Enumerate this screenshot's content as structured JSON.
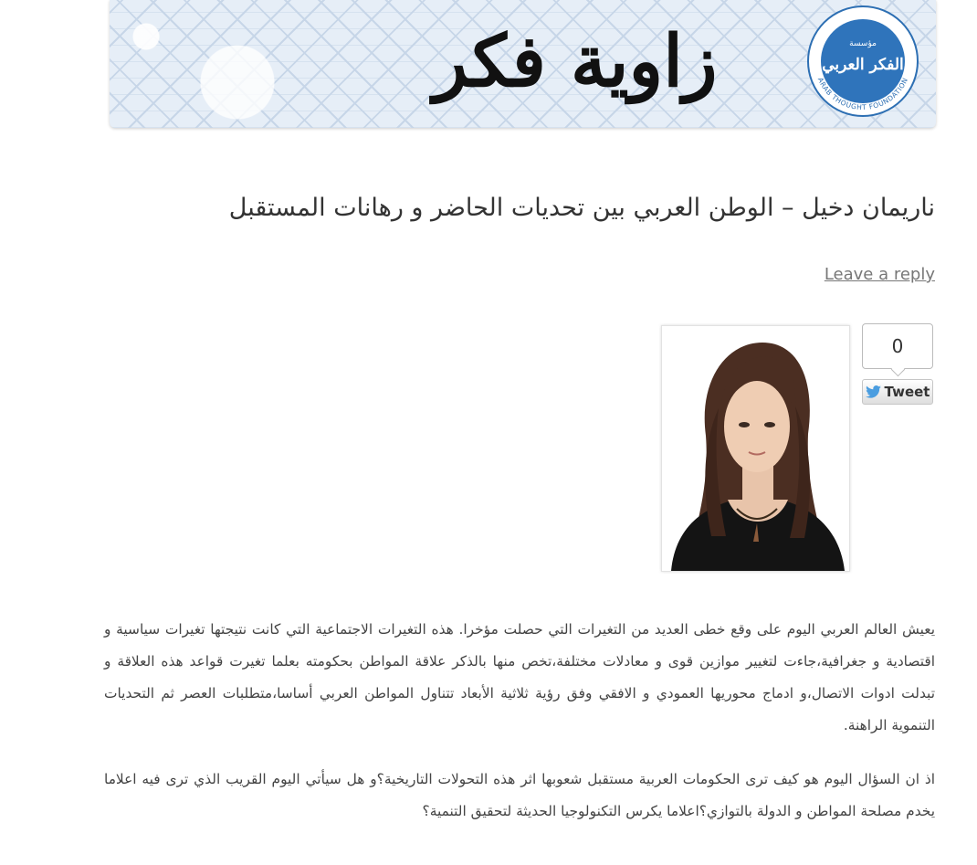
{
  "banner": {
    "title": "زاوية فكر",
    "logo": {
      "arabic_small": "مؤسسة",
      "arabic_main": "الفكر العربي",
      "english_ring": "ARAB THOUGHT FOUNDATION"
    }
  },
  "post": {
    "title": "ناريمان دخيل – الوطن العربي بين تحديات الحاضر و رهانات المستقبل",
    "reply_label": "Leave a reply"
  },
  "tweet": {
    "count": "0",
    "button_label": "Tweet",
    "icon": "twitter-bird-icon",
    "accent": "#4a9de0"
  },
  "photo": {
    "alt": "portrait-photo"
  },
  "body": {
    "paragraphs": [
      "يعيش العالم العربي اليوم على وقع خطى العديد من التغيرات التي حصلت مؤخرا. هذه التغيرات الاجتماعية التي كانت نتيجتها تغيرات سياسية و اقتصادية و جغرافية،جاءت لتغيير موازين قوى و معادلات مختلفة،تخص منها بالذكر علاقة المواطن بحكومته بعلما تغيرت قواعد هذه العلاقة و تبدلت ادوات الاتصال،و ادماج محوريها العمودي و الافقي وفق رؤية ثلاثية الأبعاد تتناول المواطن العربي أساسا،متطلبات العصر ثم التحديات التنموية الراهنة.",
      "اذ ان السؤال اليوم هو كيف ترى الحكومات العربية مستقبل شعوبها اثر هذه التحولات التاريخية؟و هل سيأتي اليوم القريب الذي ترى فيه اعلاما يخدم مصلحة المواطن و الدولة بالتوازي؟اعلاما يكرس التكنولوجيا الحديثة لتحقيق التنمية؟"
    ]
  }
}
